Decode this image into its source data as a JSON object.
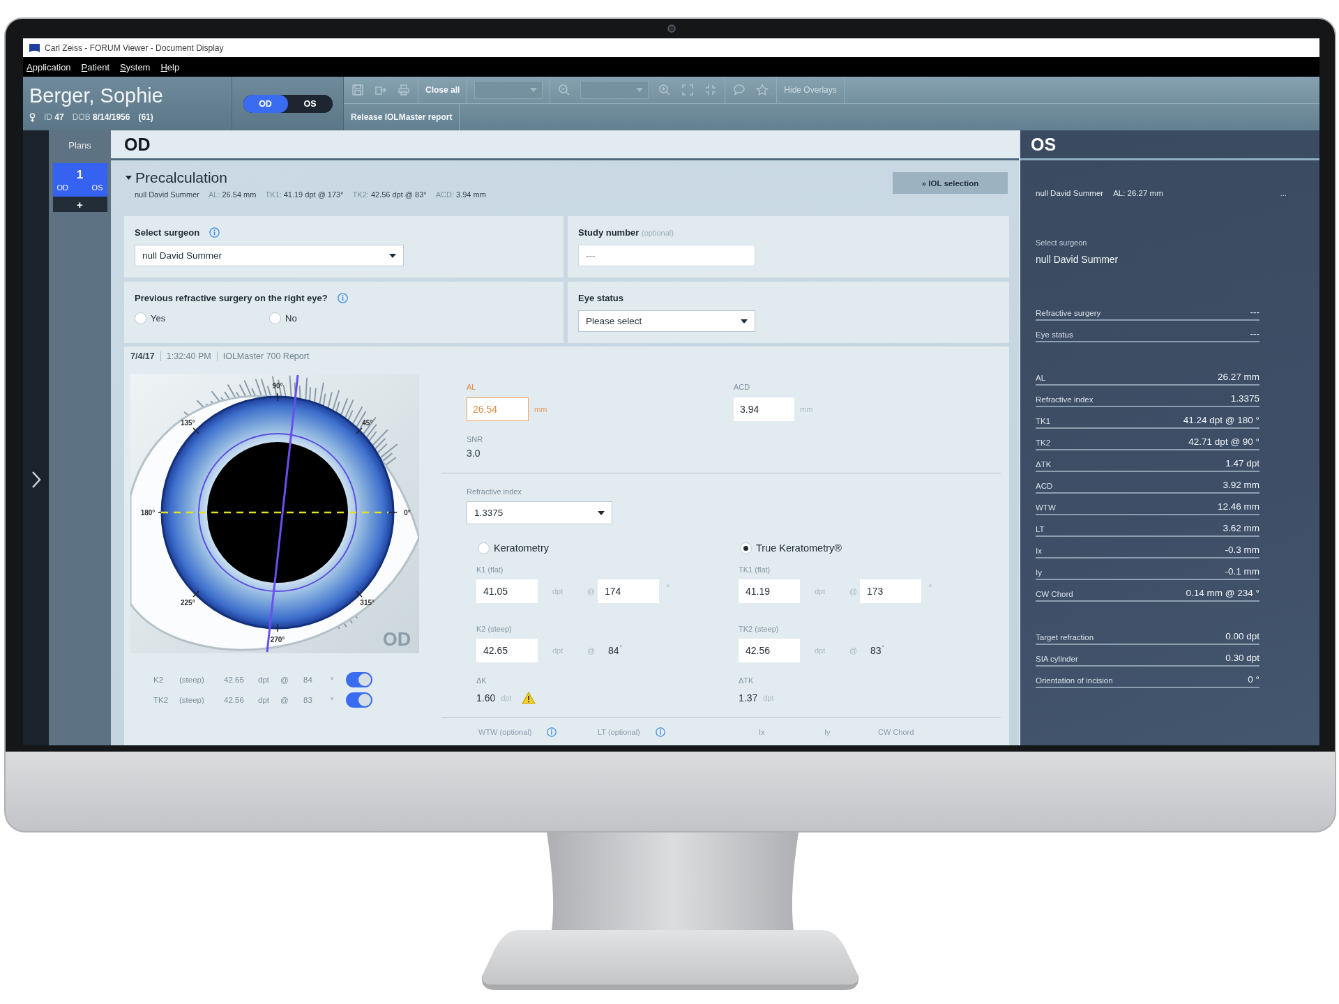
{
  "window": {
    "title": "Carl Zeiss - FORUM Viewer - Document Display"
  },
  "menu": [
    "Application",
    "Patient",
    "System",
    "Help"
  ],
  "patient": {
    "name": "Berger, Sophie",
    "id_label": "ID",
    "id": "47",
    "dob_label": "DOB",
    "dob": "8/14/1956",
    "age": "(61)"
  },
  "eye_switch": [
    {
      "label": "OD",
      "selected": true
    },
    {
      "label": "OS",
      "selected": false
    }
  ],
  "toolbar": {
    "rows": [
      [
        [
          {
            "kind": "icon",
            "disabled": true
          },
          {
            "kind": "icon",
            "disabled": true
          },
          {
            "kind": "icon",
            "disabled": true
          }
        ],
        [
          {
            "kind": "button",
            "label": "Close all",
            "disabled": false
          }
        ],
        [
          {
            "kind": "dropdown",
            "disabled": true
          }
        ],
        [
          {
            "kind": "icon",
            "disabled": true
          },
          {
            "kind": "dropdown",
            "disabled": true
          },
          {
            "kind": "icon",
            "disabled": true
          },
          {
            "kind": "icon",
            "disabled": true
          },
          {
            "kind": "icon",
            "disabled": true
          }
        ],
        [
          {
            "kind": "icon",
            "disabled": true
          },
          {
            "kind": "icon",
            "disabled": true
          }
        ],
        [
          {
            "kind": "button",
            "label": "Hide Overlays",
            "disabled": true
          }
        ]
      ],
      [
        [
          {
            "kind": "button",
            "label": "Release IOLMaster report",
            "disabled": false
          }
        ]
      ]
    ]
  },
  "plans": {
    "title": "Plans",
    "items": [
      {
        "number": "1",
        "eyes": [
          "OD",
          "OS"
        ],
        "selected": true
      }
    ],
    "add": "+"
  },
  "od_panel": {
    "title": "OD",
    "precalculation": {
      "title": "Precalculation",
      "expanded": true,
      "summary": [
        {
          "value": "null David Summer"
        },
        {
          "label": "AL:",
          "value": "26.54 mm"
        },
        {
          "label": "TK1:",
          "value": "41.19 dpt @ 173°"
        },
        {
          "label": "TK2:",
          "value": "42.56 dpt @ 83°"
        },
        {
          "label": "ACD:",
          "value": "3.94 mm"
        }
      ],
      "action": "» IOL selection"
    },
    "surgeon": {
      "label": "Select surgeon",
      "info": true,
      "value": "null David Summer"
    },
    "study_number": {
      "label": "Study number",
      "note": "(optional)",
      "placeholder": "---"
    },
    "refractive_surgery": {
      "question": "Previous refractive surgery on the right eye?",
      "info": true,
      "options": [
        {
          "label": "Yes",
          "selected": false
        },
        {
          "label": "No",
          "selected": false
        }
      ]
    },
    "eye_status": {
      "label": "Eye status",
      "value": "Please select"
    },
    "report": {
      "date": "7/4/17",
      "time": "1:32:40 PM",
      "source": "IOLMaster 700 Report",
      "eye_diagram": {
        "angle_labels": [
          "90°",
          "45°",
          "135°",
          "0°",
          "180°",
          "225°",
          "270°",
          "315°"
        ],
        "eye_label": "OD"
      },
      "axis_rows": [
        {
          "label": "K2",
          "qualifier": "(steep)",
          "value": "42.65",
          "unit": "dpt",
          "at": "@",
          "axis": "84",
          "degree": "°",
          "on": true
        },
        {
          "label": "TK2",
          "qualifier": "(steep)",
          "value": "42.56",
          "unit": "dpt",
          "at": "@",
          "axis": "83",
          "degree": "°",
          "on": true
        }
      ],
      "measures": [
        {
          "label": "AL",
          "value": "26.54",
          "unit": "mm",
          "warning": true
        },
        {
          "label": "ACD",
          "value": "3.94",
          "unit": "mm",
          "warning": false
        }
      ],
      "snr": {
        "label": "SNR",
        "value": "3.0"
      },
      "refractive_index": {
        "label": "Refractive index",
        "value": "1.3375"
      },
      "keratometry": [
        {
          "label": "Keratometry",
          "selected": false,
          "rows": [
            {
              "kind": "input",
              "label": "K1 (flat)",
              "value": "41.05",
              "unit": "dpt",
              "at": "@",
              "axis": "174",
              "degree": "°"
            },
            {
              "kind": "static",
              "label": "K2 (steep)",
              "value": "42.65",
              "unit": "dpt",
              "at": "@",
              "axis": "84",
              "degree": "°"
            }
          ],
          "delta": {
            "label": "ΔK",
            "value": "1.60",
            "unit": "dpt",
            "warning": true
          }
        },
        {
          "label": "True Keratometry®",
          "selected": true,
          "rows": [
            {
              "kind": "input",
              "label": "TK1 (flat)",
              "value": "41.19",
              "unit": "dpt",
              "at": "@",
              "axis": "173",
              "degree": "°"
            },
            {
              "kind": "static",
              "label": "TK2 (steep)",
              "value": "42.56",
              "unit": "dpt",
              "at": "@",
              "axis": "83",
              "degree": "°"
            }
          ],
          "delta": {
            "label": "ΔTK",
            "value": "1.37",
            "unit": "dpt",
            "warning": false
          }
        }
      ],
      "more_fields": [
        {
          "label": "WTW",
          "note": "(optional)",
          "info": true
        },
        {
          "label": "LT",
          "note": "(optional)",
          "info": true
        },
        {
          "label": "Ix",
          "info": false
        },
        {
          "label": "Iy",
          "info": false
        },
        {
          "label": "CW Chord",
          "info": false
        }
      ]
    }
  },
  "os_panel": {
    "title": "OS",
    "summary": [
      {
        "value": "null David Summer"
      },
      {
        "label": "AL:",
        "value": "26.27 mm"
      }
    ],
    "more": "...",
    "surgeon": {
      "label": "Select surgeon",
      "value": "null David Summer"
    },
    "groups": [
      [
        {
          "label": "Refractive surgery",
          "value": "---"
        },
        {
          "label": "Eye status",
          "value": "---"
        }
      ],
      [
        {
          "label": "AL",
          "value": "26.27 mm"
        },
        {
          "label": "Refractive index",
          "value": "1.3375"
        },
        {
          "label": "TK1",
          "value": "41.24 dpt @ 180 °"
        },
        {
          "label": "TK2",
          "value": "42.71 dpt @ 90 °"
        },
        {
          "label": "ΔTK",
          "value": "1.47 dpt"
        },
        {
          "label": "ACD",
          "value": "3.92 mm"
        },
        {
          "label": "WTW",
          "value": "12.46 mm"
        },
        {
          "label": "LT",
          "value": "3.62 mm"
        },
        {
          "label": "Ix",
          "value": "-0.3 mm"
        },
        {
          "label": "Iy",
          "value": "-0.1 mm"
        },
        {
          "label": "CW Chord",
          "value": "0.14 mm @ 234 °"
        }
      ],
      [
        {
          "label": "Target refraction",
          "value": "0.00 dpt"
        },
        {
          "label": "SIA cylinder",
          "value": "0.30 dpt"
        },
        {
          "label": "Orientation of incision",
          "value": "0 °"
        }
      ]
    ]
  }
}
